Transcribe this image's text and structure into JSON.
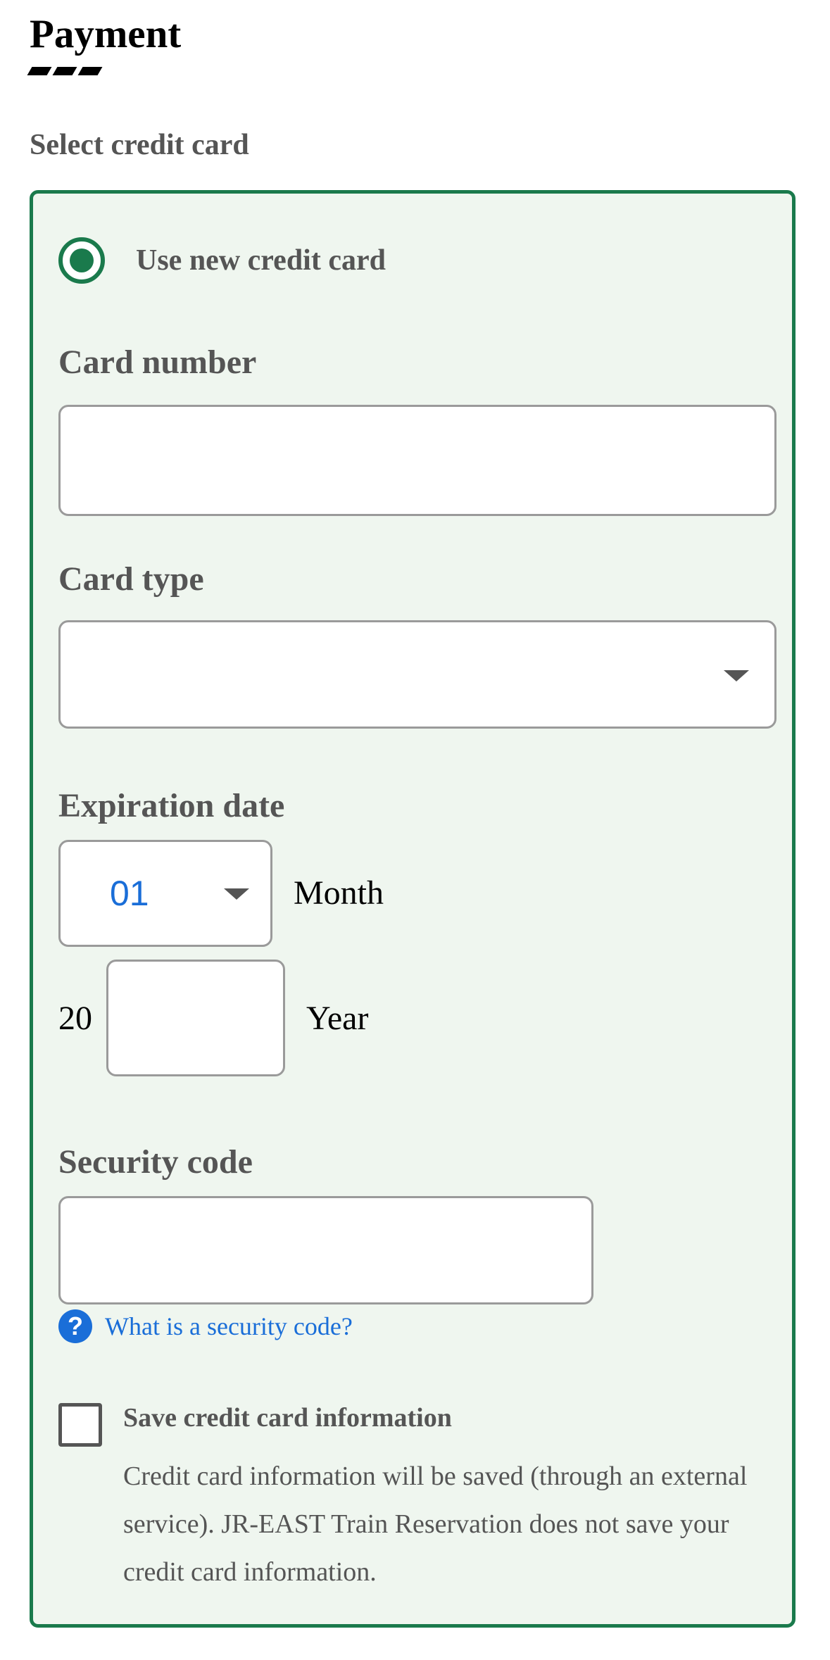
{
  "page": {
    "title": "Payment"
  },
  "select_card": {
    "label": "Select credit card",
    "option_new_card": "Use new credit card"
  },
  "card_number": {
    "label": "Card number",
    "value": ""
  },
  "card_type": {
    "label": "Card type",
    "value": ""
  },
  "expiration": {
    "label": "Expiration date",
    "month_value": "01",
    "month_label": "Month",
    "year_prefix": "20",
    "year_value": "",
    "year_label": "Year"
  },
  "security_code": {
    "label": "Security code",
    "value": "",
    "help_link": "What is a security code?",
    "help_icon": "?"
  },
  "save_card": {
    "label": "Save credit card information",
    "description": "Credit card information will be saved (through an external service). JR-EAST Train Reservation does not save your credit card information.",
    "checked": false
  },
  "colors": {
    "accent_green": "#1a7a4c",
    "panel_background": "#eff6ef",
    "link_blue": "#1a6ed8",
    "label_gray": "#555555"
  }
}
